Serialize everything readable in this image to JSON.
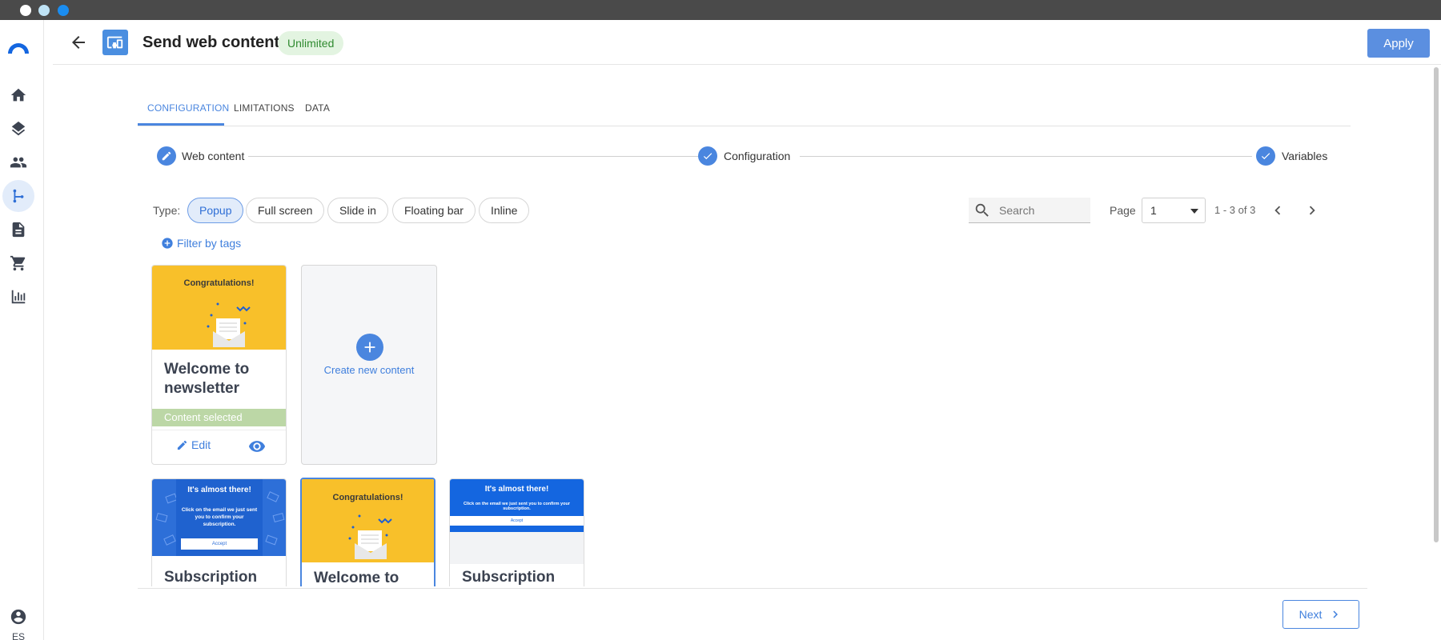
{
  "header": {
    "title": "Send web content",
    "badge": "Unlimited",
    "apply_label": "Apply"
  },
  "sidebar": {
    "items": [
      {
        "name": "home-icon"
      },
      {
        "name": "layers-icon"
      },
      {
        "name": "people-icon"
      },
      {
        "name": "flow-icon",
        "active": true
      },
      {
        "name": "document-icon"
      },
      {
        "name": "cart-icon"
      },
      {
        "name": "bar-chart-icon"
      }
    ],
    "language": "ES"
  },
  "tabs": [
    {
      "label": "CONFIGURATION",
      "active": true
    },
    {
      "label": "LIMITATIONS"
    },
    {
      "label": "DATA"
    }
  ],
  "stepper": [
    {
      "label": "Web content",
      "icon": "pencil-icon"
    },
    {
      "label": "Configuration",
      "icon": "check-icon"
    },
    {
      "label": "Variables",
      "icon": "check-icon"
    }
  ],
  "filters": {
    "type_label": "Type:",
    "types": [
      {
        "label": "Popup",
        "active": true
      },
      {
        "label": "Full screen"
      },
      {
        "label": "Slide in"
      },
      {
        "label": "Floating bar"
      },
      {
        "label": "Inline"
      }
    ],
    "filter_by_tags": "Filter by tags"
  },
  "search": {
    "placeholder": "Search"
  },
  "pagination": {
    "page_label": "Page",
    "current_page": "1",
    "range": "1 - 3 of 3"
  },
  "cards": {
    "selected": {
      "thumb_title": "Congratulations!",
      "name": "Welcome to newsletter",
      "status": "Content selected",
      "edit_label": "Edit"
    },
    "create": {
      "label": "Create new content"
    },
    "row2": [
      {
        "name": "Subscription",
        "thumb_title": "It's almost there!",
        "thumb_body": "Click on the email we just sent you to confirm your subscription.",
        "thumb_button": "Accept"
      },
      {
        "name": "Welcome to",
        "thumb_title": "Congratulations!"
      },
      {
        "name": "Subscription",
        "thumb_title": "It's almost there!",
        "thumb_body": "Click on the email we just sent you to confirm your subscription.",
        "thumb_button": "Accept"
      }
    ]
  },
  "footer": {
    "next_label": "Next"
  },
  "colors": {
    "accent": "#4a86df",
    "badge_bg": "#e3f4e1",
    "selected_bar": "#bcd7a6",
    "popup_yellow": "#f8c02a"
  }
}
